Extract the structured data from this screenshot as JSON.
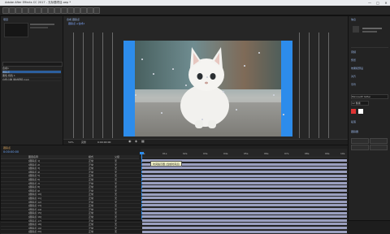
{
  "app": {
    "title": "Adobe After Effects CC 2017 - 无标题项目.aep *"
  },
  "window": {
    "minimize": "—",
    "maximize": "□",
    "close": "✕"
  },
  "project": {
    "tab": "项目",
    "search_placeholder": "",
    "items": [
      {
        "name": "合成1",
        "type": "合成"
      },
      {
        "name": "跟踪点",
        "type": "合成"
      },
      {
        "name": "黑色 纯色 1",
        "type": "纯色"
      },
      {
        "name": "白色小猫 素材视频.mp4",
        "type": "视频"
      }
    ]
  },
  "composition": {
    "tab": "合成 跟踪点",
    "breadcrumb": "跟踪点 ◂ 合成1",
    "zoom": "50%",
    "resolution": "完整",
    "timecode": "0:00:00:00"
  },
  "timeline": {
    "tab": "跟踪点",
    "timecode": "0:00:00:00",
    "column_name": "图层名称",
    "column_mode": "模式",
    "column_parent": "父级",
    "ruler": [
      "0s",
      "01s",
      "02s",
      "03s",
      "04s",
      "05s",
      "06s",
      "07s",
      "08s",
      "09s",
      "10s"
    ],
    "tooltip": "时间指示器 (当前时间点)",
    "layers": [
      "[跟踪点 1]",
      "[跟踪点 2]",
      "[跟踪点 3]",
      "[跟踪点 4]",
      "[跟踪点 5]",
      "[跟踪点 6]",
      "[跟踪点 7]",
      "[跟踪点 8]",
      "[跟踪点 9]",
      "[跟踪点 10]",
      "[跟踪点 11]",
      "[跟踪点 12]",
      "[跟踪点 13]",
      "[跟踪点 14]",
      "[跟踪点 15]",
      "[跟踪点 16]",
      "[跟踪点 17]",
      "[跟踪点 18]",
      "[跟踪点 19]",
      "[跟踪点 20]"
    ],
    "mode": "正常",
    "parent": "无"
  },
  "right_panel": {
    "tabs": [
      "信息",
      "音频",
      "预览",
      "效果和预设",
      "对齐",
      "字符",
      "段落",
      "跟踪器"
    ],
    "font": "Microsoft YaHei",
    "font_size": "12 像素"
  },
  "colors": {
    "accent": "#2d8ceb",
    "timeline_bar": "#9a9fbf",
    "ui_bg": "#232323"
  }
}
